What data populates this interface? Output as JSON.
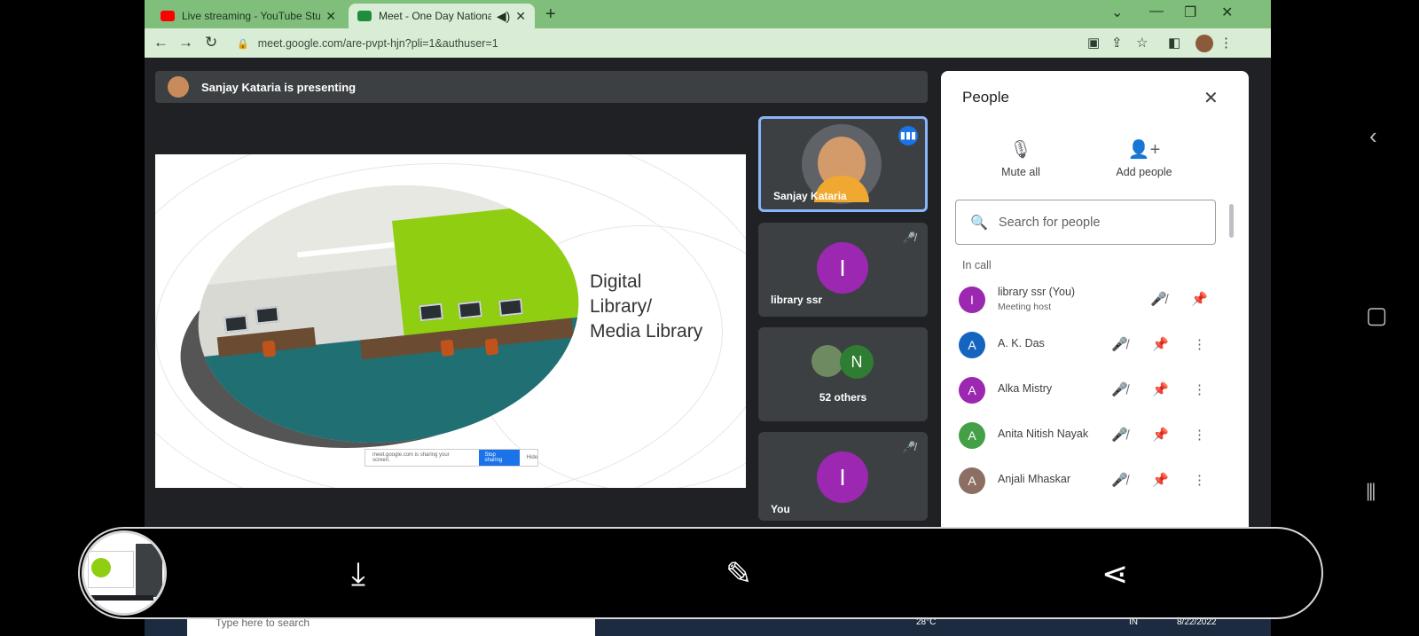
{
  "browser": {
    "tabs": [
      {
        "title": "Live streaming - YouTube Studio",
        "close": "✕",
        "color": "#ff0000"
      },
      {
        "title": "Meet - One Day National Lit",
        "close": "✕",
        "color": "#1e8e3e"
      }
    ],
    "new_tab": "+",
    "url": "meet.google.com/are-pvpt-hjn?pli=1&authuser=1",
    "tab_bar_color": "#7fbf7b"
  },
  "meeting": {
    "presenting_text": "Sanjay Kataria is presenting",
    "slide": {
      "caption_lines": [
        "Digital",
        "Library/",
        "Media Library"
      ],
      "share_note": "meet.google.com is sharing your screen.",
      "stop_sharing": "Stop sharing",
      "hide": "Hide"
    },
    "tiles": [
      {
        "name": "Sanjay Kataria",
        "speaking": true
      },
      {
        "name": "library ssr",
        "initial": "I",
        "avatar_color": "#9c27b0",
        "muted": true
      },
      {
        "name": "52 others",
        "initial": "N",
        "avatar_color": "#2e7d32"
      },
      {
        "name": "You",
        "initial": "I",
        "avatar_color": "#9c27b0",
        "muted": true
      }
    ]
  },
  "people": {
    "title": "People",
    "close_icon": "close-icon",
    "actions": [
      {
        "label": "Mute all",
        "icon": "mic-off-icon"
      },
      {
        "label": "Add people",
        "icon": "person-add-icon"
      }
    ],
    "search_placeholder": "Search for people",
    "section": "In call",
    "participants": [
      {
        "name": "library ssr (You)",
        "sub": "Meeting host",
        "initial": "I",
        "color": "#9c27b0"
      },
      {
        "name": "A. K. Das",
        "initial": "A",
        "color": "#1565c0"
      },
      {
        "name": "Alka Mistry",
        "initial": "A",
        "color": "#9c27b0"
      },
      {
        "name": "Anita Nitish Nayak",
        "initial": "A",
        "color": "#43a047"
      },
      {
        "name": "Anjali Mhaskar",
        "initial": "A",
        "color": "#8d6e63"
      }
    ]
  },
  "taskbar": {
    "search_text": "Type here to search",
    "temperature": "28°C",
    "lang": "IN",
    "date": "8/22/2022"
  }
}
